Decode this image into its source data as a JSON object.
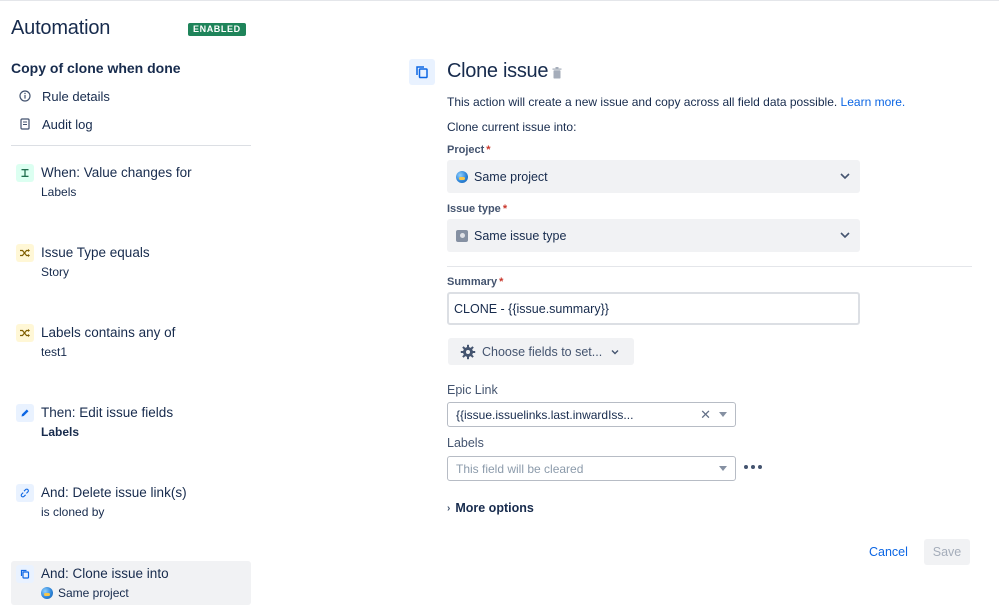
{
  "sidebar": {
    "app_title": "Automation",
    "status_badge": "ENABLED",
    "rule_name": "Copy of clone when done",
    "links": [
      {
        "label": "Rule details",
        "icon": "info-icon"
      },
      {
        "label": "Audit log",
        "icon": "document-icon"
      }
    ],
    "components": [
      {
        "title": "When: Value changes for",
        "subtitle": "Labels",
        "icon": "trigger-icon",
        "color": "green"
      },
      {
        "title": "Issue Type equals",
        "subtitle": "Story",
        "icon": "condition-shuffle-icon",
        "color": "yellow"
      },
      {
        "title": "Labels contains any of",
        "subtitle": "test1",
        "icon": "condition-shuffle-icon",
        "color": "yellow"
      },
      {
        "title": "Then: Edit issue fields",
        "subtitle": "Labels",
        "icon": "pencil-icon",
        "color": "blue"
      },
      {
        "title": "And: Delete issue link(s)",
        "subtitle": "is cloned by",
        "icon": "unlink-icon",
        "color": "blue"
      },
      {
        "title": "And: Clone issue into",
        "subtitle": "Same project",
        "icon": "copy-icon",
        "color": "blue"
      }
    ]
  },
  "action": {
    "title": "Clone issue",
    "description": "This action will create a new issue and copy across all field data possible.",
    "learn_more": "Learn more.",
    "clone_into_label": "Clone current issue into:",
    "project": {
      "label": "Project",
      "required_mark": "*",
      "value": "Same project"
    },
    "issue_type": {
      "label": "Issue type",
      "required_mark": "*",
      "value": "Same issue type"
    },
    "summary": {
      "label": "Summary",
      "required_mark": "*",
      "value": "CLONE - {{issue.summary}}"
    },
    "choose_fields_label": "Choose fields to set...",
    "epic_link": {
      "label": "Epic Link",
      "value": "{{issue.issuelinks.last.inwardIss..."
    },
    "labels": {
      "label": "Labels",
      "placeholder": "This field will be cleared"
    },
    "more_options": "More options",
    "cancel_label": "Cancel",
    "save_label": "Save"
  },
  "colors": {
    "accent": "#0c66e4",
    "badge_green": "#1f845a",
    "required": "#c9372c"
  }
}
